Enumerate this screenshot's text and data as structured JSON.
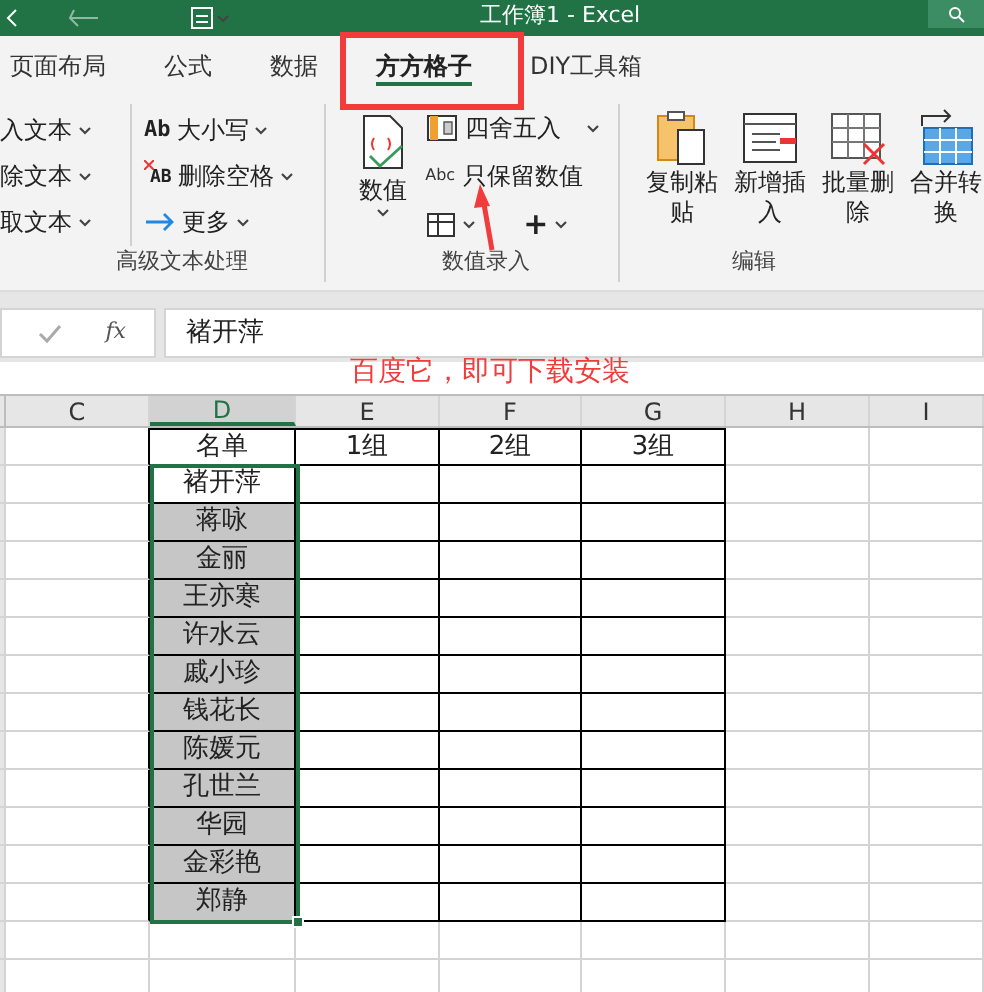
{
  "window": {
    "title": "工作簿1  -  Excel"
  },
  "tabs": [
    {
      "label": "页面布局",
      "selected": false
    },
    {
      "label": "公式",
      "selected": false
    },
    {
      "label": "数据",
      "selected": false
    },
    {
      "label": "方方格子",
      "selected": true
    },
    {
      "label": "DIY工具箱",
      "selected": false
    }
  ],
  "ribbon": {
    "groups": [
      {
        "label": "高级文本处理",
        "columns": [
          [
            {
              "label": "入文本"
            },
            {
              "label": "除文本"
            },
            {
              "label": "取文本"
            }
          ],
          [
            {
              "label": "大小写",
              "icon_text": "Ab",
              "kind": "case"
            },
            {
              "label": "删除空格",
              "icon_text": "AB",
              "kind": "trim"
            },
            {
              "label": "更多",
              "kind": "more"
            }
          ]
        ]
      },
      {
        "label": "数值录入",
        "big": {
          "label": "数值"
        },
        "items": [
          {
            "label": "四舍五入",
            "kind": "round"
          },
          {
            "label": "只保留数值",
            "icon_text": "Abc",
            "kind": "abc"
          }
        ],
        "small": [
          {
            "kind": "table"
          },
          {
            "kind": "plus",
            "icon_text": "+"
          }
        ]
      },
      {
        "label": "编辑",
        "buttons": [
          {
            "label": "复制粘贴",
            "kind": "paste"
          },
          {
            "label": "新增插入",
            "kind": "insert"
          },
          {
            "label": "批量删除",
            "kind": "delete"
          },
          {
            "label": "合并转换",
            "kind": "merge"
          }
        ]
      }
    ]
  },
  "formula_bar": {
    "fx": "fx",
    "value": "褚开萍"
  },
  "sheet": {
    "columns": [
      {
        "label": "C",
        "selected": false
      },
      {
        "label": "D",
        "selected": true
      },
      {
        "label": "E",
        "selected": false
      },
      {
        "label": "F",
        "selected": false
      },
      {
        "label": "G",
        "selected": false
      },
      {
        "label": "H",
        "selected": false
      },
      {
        "label": "I",
        "selected": false
      }
    ],
    "header_row": [
      "名单",
      "1组",
      "2组",
      "3组"
    ],
    "names": [
      {
        "text": "褚开萍",
        "selected": false
      },
      {
        "text": "蒋咏",
        "selected": true
      },
      {
        "text": "金丽",
        "selected": true
      },
      {
        "text": "王亦寒",
        "selected": true
      },
      {
        "text": "许水云",
        "selected": true
      },
      {
        "text": "戚小珍",
        "selected": true
      },
      {
        "text": "钱花长",
        "selected": true
      },
      {
        "text": "陈媛元",
        "selected": true
      },
      {
        "text": "孔世兰",
        "selected": true
      },
      {
        "text": "华园",
        "selected": true
      },
      {
        "text": "金彩艳",
        "selected": true
      },
      {
        "text": "郑静",
        "selected": true
      }
    ]
  },
  "annotation": {
    "text": "百度它，即可下载安装"
  }
}
